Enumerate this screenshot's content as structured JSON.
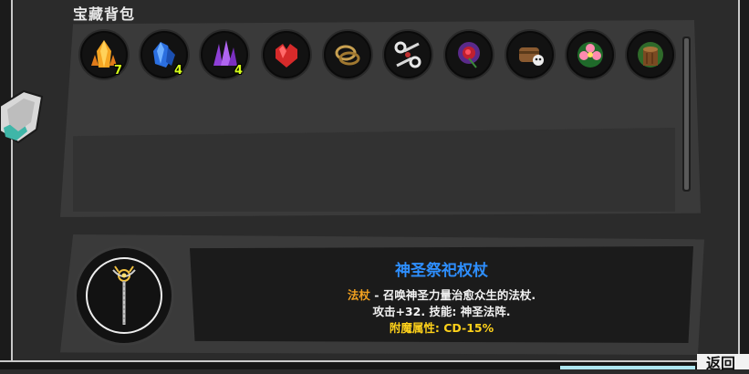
{
  "inventory": {
    "title": "宝藏背包",
    "items": [
      {
        "icon": "amber-crystal-icon",
        "count": "7"
      },
      {
        "icon": "blue-crystal-icon",
        "count": "4"
      },
      {
        "icon": "purple-crystal-icon",
        "count": "4"
      },
      {
        "icon": "red-gem-icon",
        "count": ""
      },
      {
        "icon": "gold-ring-icon",
        "count": ""
      },
      {
        "icon": "scissors-icon",
        "count": ""
      },
      {
        "icon": "red-rose-icon",
        "count": ""
      },
      {
        "icon": "skull-treasure-icon",
        "count": ""
      },
      {
        "icon": "pink-flower-icon",
        "count": ""
      },
      {
        "icon": "tree-stump-icon",
        "count": ""
      }
    ]
  },
  "detail": {
    "name": "神圣祭祀权杖",
    "type_label": "法杖",
    "type_desc": " - 召唤神圣力量治愈众生的法杖.",
    "stats": "攻击+32. 技能: 神圣法阵.",
    "enchant": "附魔属性: CD-15%",
    "icon": "holy-scepter-icon"
  },
  "buttons": {
    "return_label": "返回"
  },
  "colors": {
    "item_name": "#2e8fff",
    "type_label": "#f0a020",
    "enchant": "#ffd21a",
    "count": "#d6ff1a"
  }
}
